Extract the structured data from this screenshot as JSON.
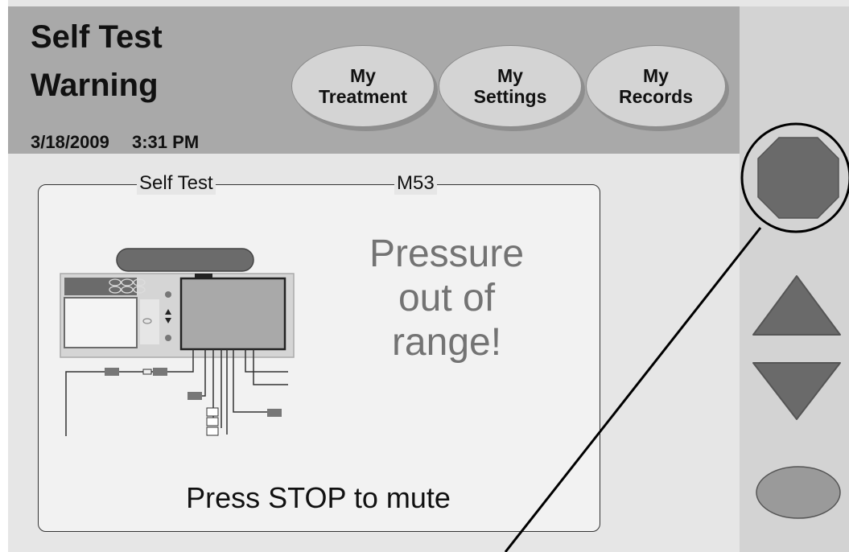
{
  "header": {
    "title_line1": "Self Test",
    "title_line2": "Warning",
    "date": "3/18/2009",
    "time": "3:31 PM"
  },
  "nav": [
    {
      "line1": "My",
      "line2": "Treatment"
    },
    {
      "line1": "My",
      "line2": "Settings"
    },
    {
      "line1": "My",
      "line2": "Records"
    }
  ],
  "panel": {
    "legend_left": "Self Test",
    "legend_right": "M53",
    "message_lines": [
      "Pressure",
      "out of",
      "range!"
    ],
    "footer": "Press STOP to mute"
  },
  "sidebar": {
    "stop_button": "stop-octagon-icon",
    "up_button": "triangle-up-icon",
    "down_button": "triangle-down-icon",
    "oval_button": "oval-icon"
  },
  "colors": {
    "header_bg": "#a9a9a9",
    "content_bg": "#e6e6e6",
    "sidebar_bg": "#d3d3d3",
    "button_dark": "#6a6a6a",
    "button_oval": "#9a9a9a",
    "message_text": "#737373"
  }
}
